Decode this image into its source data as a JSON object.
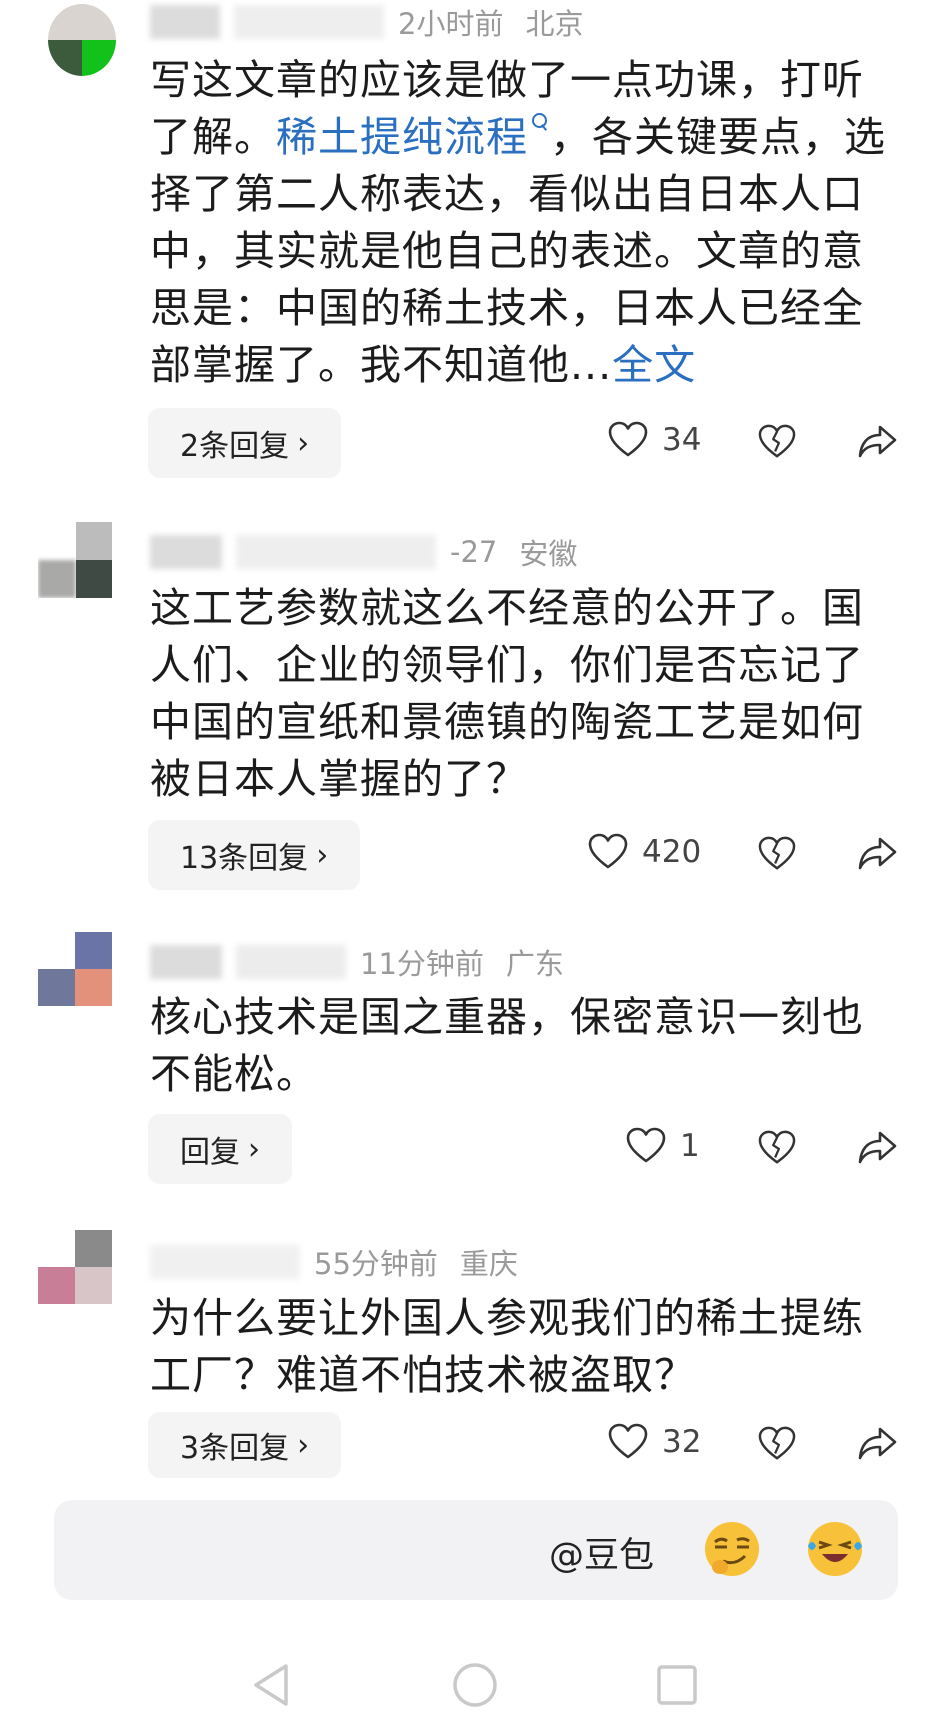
{
  "comments": [
    {
      "meta_time": "2小时前",
      "meta_location": "北京",
      "text_before": "写这文章的应该是做了一点功课，打听了解。",
      "link_text": "稀土提纯流程",
      "text_after": "，各关键要点，选择了第二人称表达，看似出自日本人口中，其实就是他自己的表述。文章的意思是：中国的稀土技术，日本人已经全部掌握了。我不知道他...",
      "more_label": "全文",
      "reply_label": "2条回复",
      "likes": "34"
    },
    {
      "meta_time": "-27",
      "meta_location": "安徽",
      "text": "这工艺参数就这么不经意的公开了。国人们、企业的领导们，你们是否忘记了中国的宣纸和景德镇的陶瓷工艺是如何被日本人掌握的了？",
      "reply_label": "13条回复",
      "likes": "420"
    },
    {
      "meta_time": "11分钟前",
      "meta_location": "广东",
      "text": "核心技术是国之重器，保密意识一刻也不能松。",
      "reply_label": "回复",
      "likes": "1"
    },
    {
      "meta_time": "55分钟前",
      "meta_location": "重庆",
      "text": "为什么要让外国人参观我们的稀土提练工厂？难道不怕技术被盗取？",
      "reply_label": "3条回复",
      "likes": "32"
    }
  ],
  "input_bar": {
    "mention": "@豆包",
    "emoji_1": "smirk-emoji",
    "emoji_2": "laughing-crying-emoji"
  },
  "nav": {
    "icons": [
      "back-icon",
      "home-icon",
      "recents-icon"
    ]
  },
  "colors": {
    "link": "#2a6fc0",
    "meta": "#9a9a9a",
    "reply_bg": "#f4f4f4"
  }
}
